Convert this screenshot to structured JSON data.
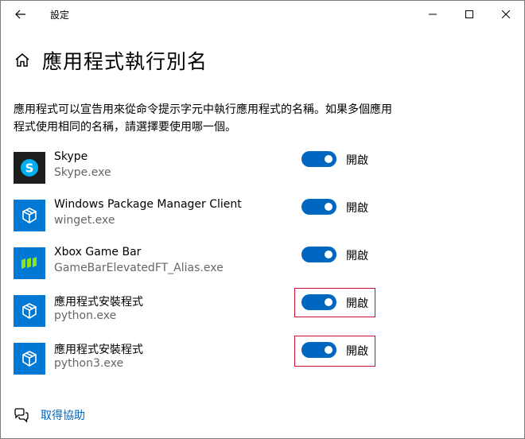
{
  "window": {
    "title": "設定"
  },
  "header": {
    "title": "應用程式執行別名"
  },
  "description": "應用程式可以宣告用來從命令提示字元中執行應用程式的名稱。如果多個應用程式使用相同的名稱，請選擇要使用哪一個。",
  "toggle_on_text": "開啟",
  "items": [
    {
      "name": "Skype",
      "exe": "Skype.exe",
      "state": "開啟",
      "on": true,
      "icon": "skype-icon",
      "icon_bg": "#1e1e1e",
      "highlighted": false
    },
    {
      "name": "Windows Package Manager Client",
      "exe": "winget.exe",
      "state": "開啟",
      "on": true,
      "icon": "package-icon",
      "icon_bg": "#0078d4",
      "highlighted": false
    },
    {
      "name": "Xbox Game Bar",
      "exe": "GameBarElevatedFT_Alias.exe",
      "state": "開啟",
      "on": true,
      "icon": "xbox-game-bar-icon",
      "icon_bg": "#0078d4",
      "highlighted": false
    },
    {
      "name": "應用程式安裝程式",
      "exe": "python.exe",
      "state": "開啟",
      "on": true,
      "icon": "package-icon",
      "icon_bg": "#0078d4",
      "highlighted": true
    },
    {
      "name": "應用程式安裝程式",
      "exe": "python3.exe",
      "state": "開啟",
      "on": true,
      "icon": "package-icon",
      "icon_bg": "#0078d4",
      "highlighted": true
    }
  ],
  "footer": {
    "help_label": "取得協助"
  },
  "colors": {
    "accent": "#0067c0",
    "highlight_border": "#c8102e",
    "secondary_text": "#666666"
  }
}
